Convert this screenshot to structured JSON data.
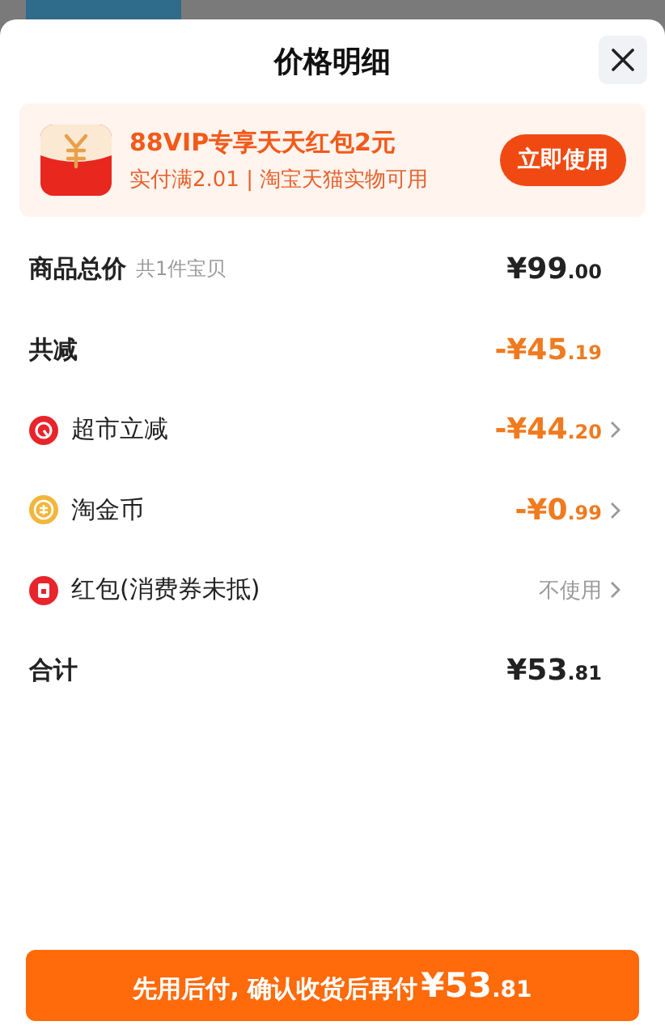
{
  "sheet": {
    "title": "价格明细"
  },
  "promo": {
    "title": "88VIP专享天天红包2元",
    "subtitle": "实付满2.01 | 淘宝天猫实物可用",
    "button": "立即使用"
  },
  "rows": [
    {
      "kind": "summary",
      "label": "商品总价",
      "note": "共1件宝贝",
      "main": "¥99",
      "decimals": ".00",
      "link": false
    },
    {
      "kind": "discount",
      "label": "共减",
      "main": "-¥45",
      "decimals": ".19",
      "link": false
    },
    {
      "kind": "item",
      "label": "超市立减",
      "color": "#e8242c",
      "main": "-¥44",
      "decimals": ".20",
      "link": true
    },
    {
      "kind": "item",
      "label": "淘金币",
      "color": "#f2b63c",
      "main": "-¥0",
      "decimals": ".99",
      "link": true
    },
    {
      "kind": "option",
      "label": "红包(消费券未抵)",
      "color": "#e8242c",
      "value": "不使用",
      "link": true
    },
    {
      "kind": "summary",
      "label": "合计",
      "main": "¥53",
      "decimals": ".81",
      "link": false
    }
  ],
  "pay_button": {
    "label": "先用后付, 确认收货后再付",
    "main": "¥53",
    "decimals": ".81"
  }
}
